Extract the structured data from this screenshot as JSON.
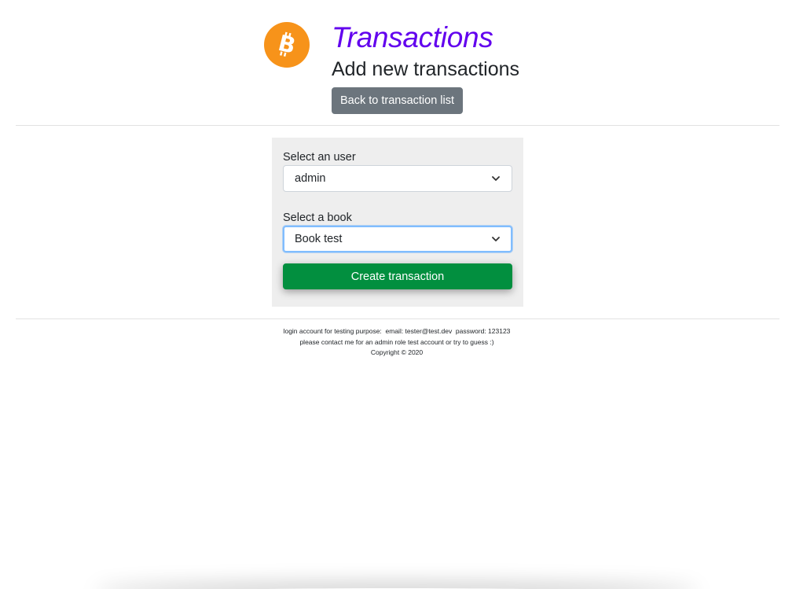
{
  "header": {
    "logo_icon": "bitcoin-icon",
    "title": "Transactions",
    "subtitle": "Add new transactions",
    "back_button_label": "Back to transaction list"
  },
  "form": {
    "user_label": "Select an user",
    "user_selected": "admin",
    "book_label": "Select a book",
    "book_selected": "Book test",
    "submit_label": "Create transaction"
  },
  "footer": {
    "line1": "login account for testing purpose:  email: tester@test.dev  password: 123123",
    "line2": "please contact me for an admin role test account or try to guess :)",
    "copyright": "Copyright © 2020"
  },
  "colors": {
    "title": "#6200ee",
    "logo": "#f7931a",
    "back_button": "#6c757d",
    "create_button": "#028f3f",
    "card_background": "#eeeeee"
  }
}
